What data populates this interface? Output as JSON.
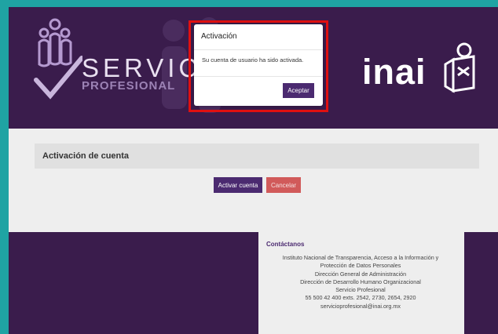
{
  "header": {
    "logo_title": "SERVICIO",
    "logo_subtitle": "PROFESIONAL",
    "brand": "inai"
  },
  "page": {
    "panel_title": "Activación de cuenta",
    "activate_button": "Activar cuenta",
    "cancel_button": "Cancelar"
  },
  "footer": {
    "contact_title": "Contáctanos",
    "lines": [
      "Instituto Nacional de Transparencia, Acceso a la Información y",
      "Protección de Datos Personales",
      "Dirección General de Administración",
      "Dirección de Desarrollo Humano Organizacional",
      "Servicio Profesional",
      "55 500 42 400 exts. 2542, 2730, 2654, 2920",
      "servicioprofesional@inai.org.mx"
    ]
  },
  "modal": {
    "title": "Activación",
    "message": "Su cuenta de usuario ha sido activada.",
    "accept_button": "Aceptar"
  },
  "colors": {
    "header_bg": "#3a1c4c",
    "accent": "#4b2a70",
    "cancel": "#d15a5a",
    "highlight": "#e01010",
    "frame": "#1fa3a3"
  }
}
